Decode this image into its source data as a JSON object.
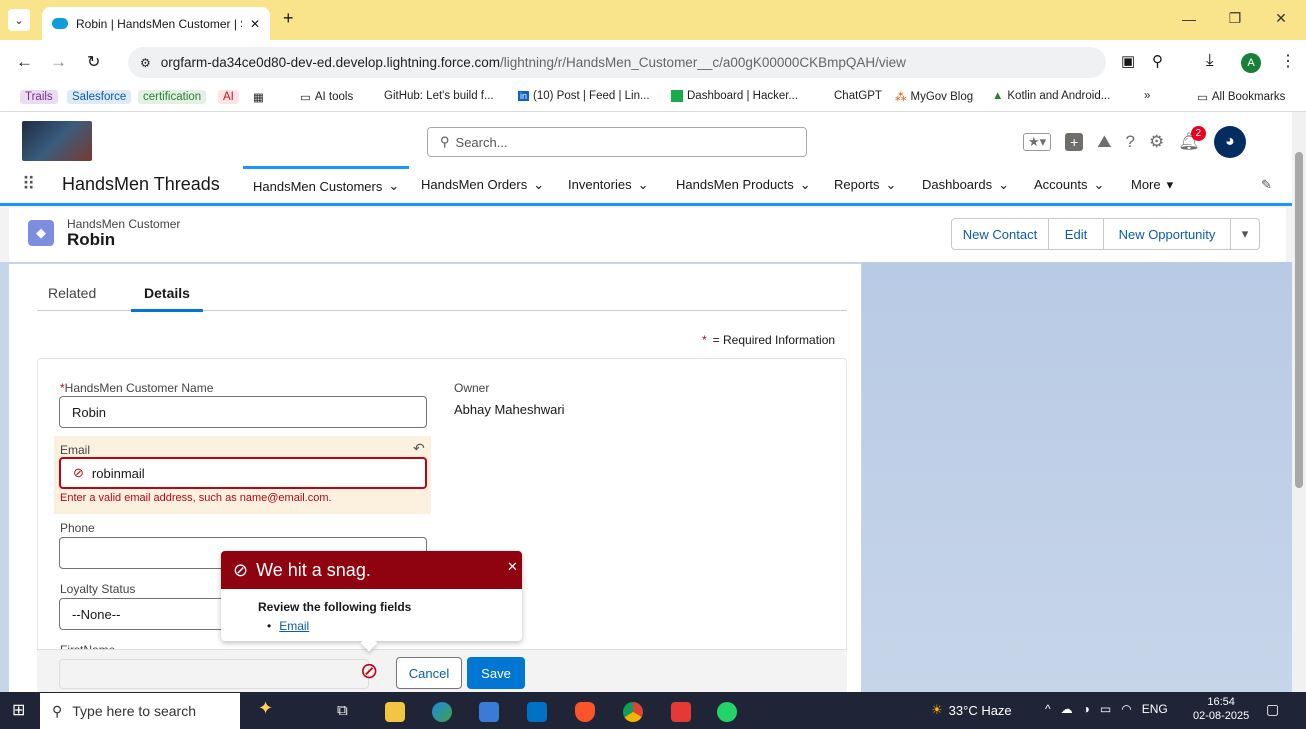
{
  "browser": {
    "tab_title": "Robin | HandsMen Customer | S",
    "url_domain": "orgfarm-da34ce0d80-dev-ed.develop.lightning.force.com",
    "url_path": "/lightning/r/HandsMen_Customer__c/a00gK00000CKBmpQAH/view",
    "profile_initial": "A",
    "bookmarks": [
      "Trails",
      "Salesforce",
      "certification",
      "AI",
      "AI tools",
      "GitHub: Let's build f...",
      "(10) Post | Feed | Lin...",
      "Dashboard | Hacker...",
      "ChatGPT",
      "MyGov Blog",
      "Kotlin and Android...",
      "»",
      "All Bookmarks"
    ]
  },
  "header": {
    "search_placeholder": "Search...",
    "notification_count": "2"
  },
  "nav": {
    "app_name": "HandsMen Threads",
    "items": [
      "HandsMen Customers",
      "HandsMen Orders",
      "Inventories",
      "HandsMen Products",
      "Reports",
      "Dashboards",
      "Accounts",
      "More"
    ]
  },
  "record": {
    "object_label": "HandsMen Customer",
    "name": "Robin",
    "actions": [
      "New Contact",
      "Edit",
      "New Opportunity"
    ]
  },
  "tabs": [
    "Related",
    "Details"
  ],
  "form": {
    "required_note": "= Required Information",
    "required_star": "*",
    "customer_name_label": "HandsMen Customer Name",
    "customer_name_value": "Robin",
    "owner_label": "Owner",
    "owner_value": "Abhay Maheshwari",
    "email_label": "Email",
    "email_value": "robinmail",
    "email_error": "Enter a valid email address, such as name@email.com.",
    "phone_label": "Phone",
    "phone_value": "",
    "loyalty_label": "Loyalty Status",
    "loyalty_value": "--None--",
    "firstname_label": "FirstName"
  },
  "error_popover": {
    "title": "We hit a snag.",
    "subtitle": "Review the following fields",
    "fields": [
      "Email"
    ]
  },
  "footer": {
    "cancel": "Cancel",
    "save": "Save"
  },
  "taskbar": {
    "search_placeholder": "Type here to search",
    "weather": "33°C Haze",
    "language": "ENG",
    "time": "16:54",
    "date": "02-08-2025"
  },
  "colors": {
    "brand_blue": "#0176d3",
    "error_red": "#ba0517",
    "popover_red": "#8e030f",
    "chrome_tab_yellow": "#f9e48b"
  }
}
